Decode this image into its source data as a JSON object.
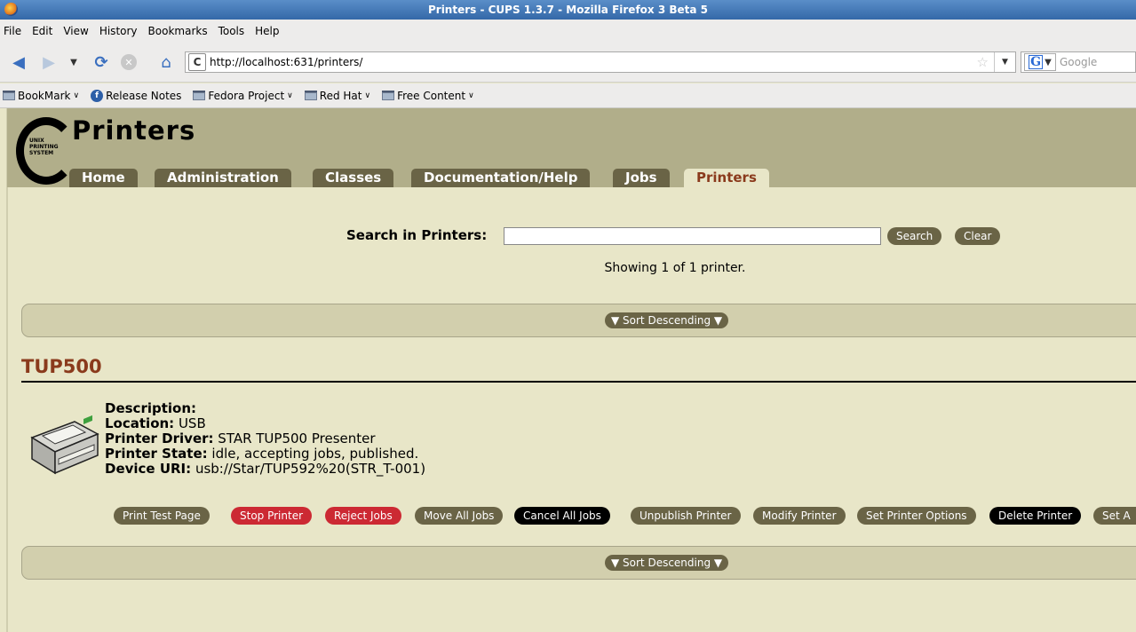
{
  "window": {
    "title": "Printers - CUPS 1.3.7 - Mozilla Firefox 3 Beta 5"
  },
  "menu": [
    "File",
    "Edit",
    "View",
    "History",
    "Bookmarks",
    "Tools",
    "Help"
  ],
  "navbar": {
    "url": "http://localhost:631/printers/",
    "search_placeholder": "Google"
  },
  "bookmarks": [
    {
      "label": "BookMark",
      "icon": "folder-icon",
      "dropdown": true
    },
    {
      "label": "Release Notes",
      "icon": "fedora-icon",
      "dropdown": false
    },
    {
      "label": "Fedora Project",
      "icon": "folder-icon",
      "dropdown": true
    },
    {
      "label": "Red Hat",
      "icon": "folder-icon",
      "dropdown": true
    },
    {
      "label": "Free Content",
      "icon": "folder-icon",
      "dropdown": true
    }
  ],
  "header": {
    "title": "Printers",
    "logo_text": [
      "UNIX",
      "PRINTING",
      "SYSTEM"
    ],
    "tabs": [
      {
        "label": "Home",
        "active": false
      },
      {
        "label": "Administration",
        "active": false
      },
      {
        "label": "Classes",
        "active": false
      },
      {
        "label": "Documentation/Help",
        "active": false
      },
      {
        "label": "Jobs",
        "active": false
      },
      {
        "label": "Printers",
        "active": true
      }
    ]
  },
  "search": {
    "label": "Search in Printers:",
    "value": "",
    "search_button": "Search",
    "clear_button": "Clear"
  },
  "showing": "Showing 1 of 1 printer.",
  "sort": {
    "label": "▼ Sort Descending ▼"
  },
  "printer": {
    "name": "TUP500",
    "description_label": "Description:",
    "description": "",
    "location_label": "Location:",
    "location": "USB",
    "driver_label": "Printer Driver:",
    "driver": "STAR TUP500 Presenter",
    "state_label": "Printer State:",
    "state": "idle, accepting jobs, published.",
    "uri_label": "Device URI:",
    "uri": "usb://Star/TUP592%20(STR_T-001)"
  },
  "actions": [
    {
      "label": "Print Test Page",
      "color": "olive"
    },
    {
      "label": "Stop Printer",
      "color": "red"
    },
    {
      "label": "Reject Jobs",
      "color": "red"
    },
    {
      "label": "Move All Jobs",
      "color": "olive"
    },
    {
      "label": "Cancel All Jobs",
      "color": "black"
    },
    {
      "label": "Unpublish Printer",
      "color": "olive"
    },
    {
      "label": "Modify Printer",
      "color": "olive"
    },
    {
      "label": "Set Printer Options",
      "color": "olive"
    },
    {
      "label": "Delete Printer",
      "color": "black"
    },
    {
      "label": "Set A",
      "color": "olive"
    }
  ],
  "colors": {
    "page_bg": "#e8e6c8",
    "header_bg": "#b1ae8a",
    "tab_bg": "#6a6446",
    "accent": "#8a3a1c",
    "danger": "#cc2933"
  }
}
